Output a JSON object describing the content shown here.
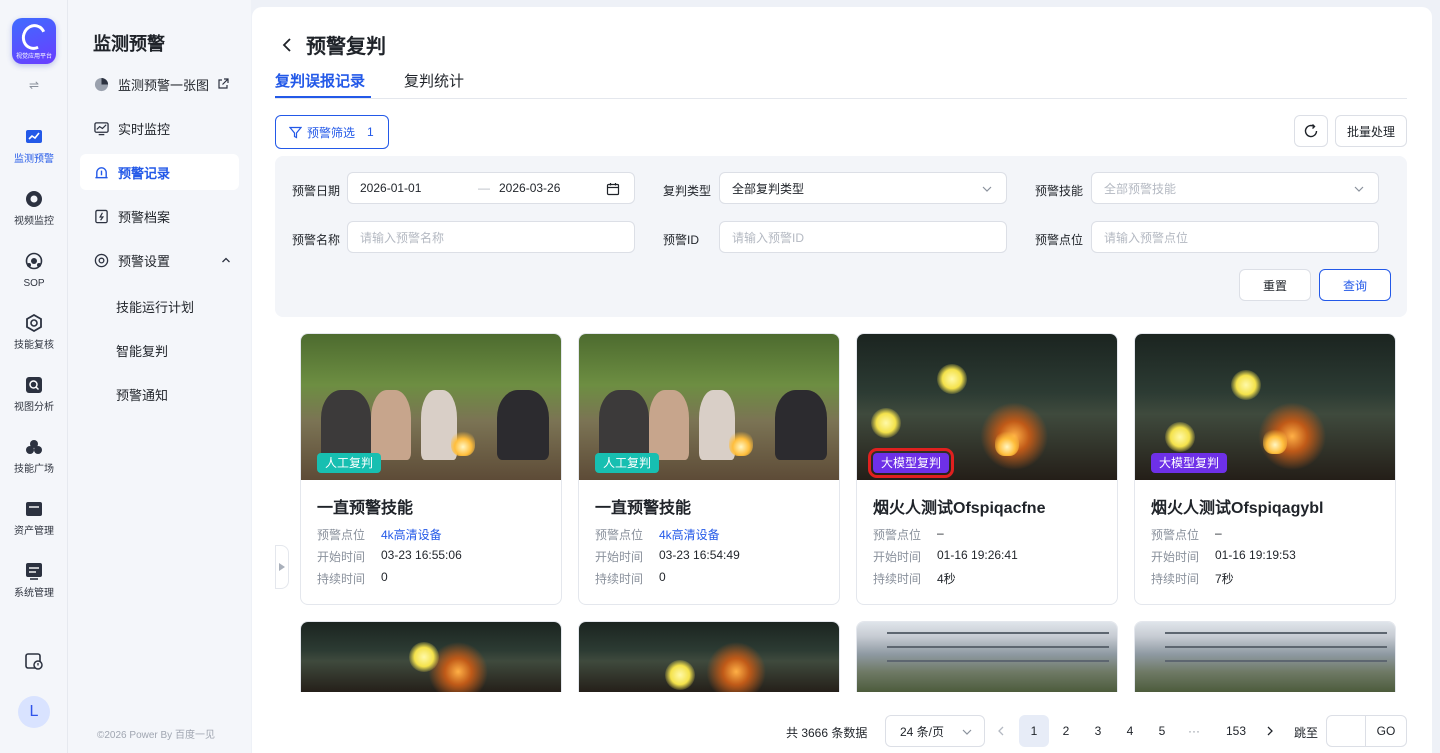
{
  "app": {
    "logo_caption": "视觉应用平台",
    "swap_icon": "⇌"
  },
  "rail": [
    {
      "label": "监测预警",
      "icon": "chart-line-icon",
      "active": true
    },
    {
      "label": "视频监控",
      "icon": "camera-icon"
    },
    {
      "label": "SOP",
      "icon": "sop-icon"
    },
    {
      "label": "技能复核",
      "icon": "hexagon-icon"
    },
    {
      "label": "视图分析",
      "icon": "image-search-icon"
    },
    {
      "label": "技能广场",
      "icon": "cluster-icon"
    },
    {
      "label": "资产管理",
      "icon": "asset-icon"
    },
    {
      "label": "系统管理",
      "icon": "system-icon"
    }
  ],
  "user": {
    "avatar_letter": "L"
  },
  "sidebar": {
    "title": "监测预警",
    "items": [
      {
        "label": "监测预警一张图"
      },
      {
        "label": "实时监控"
      },
      {
        "label": "预警记录",
        "active": true
      },
      {
        "label": "预警档案"
      },
      {
        "label": "预警设置"
      }
    ],
    "sub_items": [
      {
        "label": "技能运行计划"
      },
      {
        "label": "智能复判"
      },
      {
        "label": "预警通知"
      }
    ],
    "copyright": "©2026 Power By 百度一见"
  },
  "page": {
    "title": "预警复判",
    "tabs": [
      {
        "label": "复判误报记录",
        "active": true
      },
      {
        "label": "复判统计"
      }
    ]
  },
  "toolbar": {
    "filter_label": "预警筛选",
    "filter_count": "1",
    "batch_label": "批量处理"
  },
  "filters": {
    "date_label": "预警日期",
    "date_start": "2026-01-01",
    "date_sep": "—",
    "date_end": "2026-03-26",
    "review_type_label": "复判类型",
    "review_type_value": "全部复判类型",
    "skill_label": "预警技能",
    "skill_placeholder": "全部预警技能",
    "name_label": "预警名称",
    "name_placeholder": "请输入预警名称",
    "id_label": "预警ID",
    "id_placeholder": "请输入预警ID",
    "point_label": "预警点位",
    "point_placeholder": "请输入预警点位",
    "reset_label": "重置",
    "query_label": "查询"
  },
  "card_labels": {
    "point": "预警点位",
    "start": "开始时间",
    "duration": "持续时间"
  },
  "cards": [
    {
      "tag": "人工复判",
      "title": "一直预警技能",
      "point": "4k高清设备",
      "start": "03-23 16:55:06",
      "duration": "0"
    },
    {
      "tag": "人工复判",
      "title": "一直预警技能",
      "point": "4k高清设备",
      "start": "03-23 16:54:49",
      "duration": "0"
    },
    {
      "tag": "大模型复判",
      "title": "烟火人测试Ofspiqacfne",
      "point": "–",
      "start": "01-16 19:26:41",
      "duration": "4秒"
    },
    {
      "tag": "大模型复判",
      "title": "烟火人测试Ofspiqagybl",
      "point": "–",
      "start": "01-16 19:19:53",
      "duration": "7秒"
    }
  ],
  "pagination": {
    "total": "共 3666 条数据",
    "page_size": "24 条/页",
    "pages": [
      "1",
      "2",
      "3",
      "4",
      "5",
      "···",
      "153"
    ],
    "current": "1",
    "jump_label": "跳至",
    "go_label": "GO"
  },
  "colors": {
    "primary": "#2359e8",
    "manual_tag": "#17bfb1",
    "model_tag": "#6e30e8",
    "highlight": "#e0201f"
  }
}
